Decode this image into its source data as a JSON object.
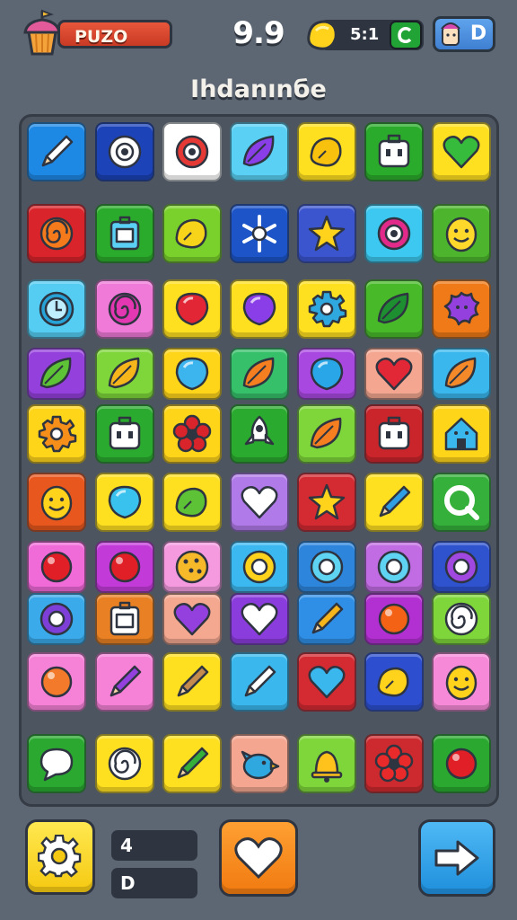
{
  "hud": {
    "player_label": "PUZO",
    "score": "9.9",
    "coins": "5:1",
    "profile_value": "D"
  },
  "title": "Ihdanınбe",
  "bottom": {
    "stat_top": "4",
    "stat_bottom": "D"
  },
  "colors": {
    "background": "#5d6774",
    "board": "#4d5560"
  },
  "board": {
    "rows": [
      [
        {
          "bg": "#1e88e5",
          "icon": "pencil-icon",
          "fg": "#ffffff"
        },
        {
          "bg": "#1c43b8",
          "icon": "target-icon",
          "fg": "#ffffff"
        },
        {
          "bg": "#ffffff",
          "icon": "target-icon",
          "fg": "#e53935"
        },
        {
          "bg": "#5ad0f4",
          "icon": "leaf-icon",
          "fg": "#8a3ee8"
        },
        {
          "bg": "#ffe020",
          "icon": "lemon-icon",
          "fg": "#f7c10e"
        },
        {
          "bg": "#2bab2b",
          "icon": "robot-icon",
          "fg": "#ffffff"
        },
        {
          "bg": "#ffe020",
          "icon": "heart-icon",
          "fg": "#36bb3c"
        }
      ],
      [
        {
          "bg": "#d8242a",
          "icon": "swirl-icon",
          "fg": "#f47a1c"
        },
        {
          "bg": "#2bab2b",
          "icon": "box-icon",
          "fg": "#5ad0f4"
        },
        {
          "bg": "#7bd12c",
          "icon": "lemon-icon",
          "fg": "#f7d31a"
        },
        {
          "bg": "#1d55c8",
          "icon": "snowflake-icon",
          "fg": "#ffffff"
        },
        {
          "bg": "#3b55cf",
          "icon": "star-icon",
          "fg": "#ffd21c"
        },
        {
          "bg": "#3cc8f0",
          "icon": "target-icon",
          "fg": "#e22a8a"
        },
        {
          "bg": "#4cb52d",
          "icon": "smiley-icon",
          "fg": "#ffd82c"
        }
      ],
      [
        {
          "bg": "#55cdf2",
          "icon": "clock-icon",
          "fg": "#28a3d8"
        },
        {
          "bg": "#ef7ad8",
          "icon": "swirl-icon",
          "fg": "#e338b1"
        },
        {
          "bg": "#ffe020",
          "icon": "balloon-icon",
          "fg": "#e32636"
        },
        {
          "bg": "#ffe020",
          "icon": "balloon-icon",
          "fg": "#8a3ee8"
        },
        {
          "bg": "#ffe020",
          "icon": "gear-icon",
          "fg": "#2fa8e0"
        },
        {
          "bg": "#48ba2a",
          "icon": "leaf-icon",
          "fg": "#1e8f30"
        },
        {
          "bg": "#ef7a17",
          "icon": "splat-icon",
          "fg": "#9340df"
        }
      ],
      [
        {
          "bg": "#9440dc",
          "icon": "leaf-icon",
          "fg": "#5dc236"
        },
        {
          "bg": "#7ed63a",
          "icon": "leaf-icon",
          "fg": "#f6b51a"
        },
        {
          "bg": "#ffd51a",
          "icon": "balloon-icon",
          "fg": "#3cb4ee"
        },
        {
          "bg": "#35c069",
          "icon": "leaf-icon",
          "fg": "#f47e20"
        },
        {
          "bg": "#a948e0",
          "icon": "balloon-icon",
          "fg": "#28a6e8"
        },
        {
          "bg": "#f4a690",
          "icon": "heart-icon",
          "fg": "#e22836"
        },
        {
          "bg": "#3ab8ee",
          "icon": "leaf-icon",
          "fg": "#f4892a"
        }
      ],
      [
        {
          "bg": "#ffd51a",
          "icon": "gear-icon",
          "fg": "#f58f1a"
        },
        {
          "bg": "#2aaa2e",
          "icon": "robot-icon",
          "fg": "#ffffff"
        },
        {
          "bg": "#ffd51a",
          "icon": "flower-icon",
          "fg": "#d8242a"
        },
        {
          "bg": "#2aaa2e",
          "icon": "rocket-icon",
          "fg": "#ffffff"
        },
        {
          "bg": "#7ed63a",
          "icon": "leaf-icon",
          "fg": "#f47e20"
        },
        {
          "bg": "#c9252b",
          "icon": "robot-icon",
          "fg": "#ffffff"
        },
        {
          "bg": "#ffd51a",
          "icon": "house-icon",
          "fg": "#3ab8ee"
        }
      ],
      [
        {
          "bg": "#e8571e",
          "icon": "smiley-icon",
          "fg": "#ffd21c"
        },
        {
          "bg": "#ffe020",
          "icon": "balloon-icon",
          "fg": "#3ac2ee"
        },
        {
          "bg": "#ffe020",
          "icon": "lemon-icon",
          "fg": "#5dc236"
        },
        {
          "bg": "#b07be8",
          "icon": "heart-icon",
          "fg": "#ffffff"
        },
        {
          "bg": "#d42a32",
          "icon": "star-icon",
          "fg": "#ffd21c"
        },
        {
          "bg": "#ffe020",
          "icon": "pencil-icon",
          "fg": "#2f9ee4"
        },
        {
          "bg": "#35b03a",
          "icon": "search-icon",
          "fg": "#ffffff"
        }
      ],
      [
        {
          "bg": "#f06ad8",
          "icon": "dot-icon",
          "fg": "#e02026"
        },
        {
          "bg": "#c23bd8",
          "icon": "dot-icon",
          "fg": "#e02026"
        },
        {
          "bg": "#f59adf",
          "icon": "cookie-icon",
          "fg": "#f6b92a"
        },
        {
          "bg": "#3cb8f0",
          "icon": "ring-icon",
          "fg": "#ffd21c"
        },
        {
          "bg": "#2e86dc",
          "icon": "ring-icon",
          "fg": "#5ed3f2"
        },
        {
          "bg": "#c16ce2",
          "icon": "ring-icon",
          "fg": "#5ed3f2"
        },
        {
          "bg": "#2f52cf",
          "icon": "ring-icon",
          "fg": "#a048e0"
        }
      ],
      [
        {
          "bg": "#3aaaea",
          "icon": "ring-icon",
          "fg": "#7e3ed8"
        },
        {
          "bg": "#e98124",
          "icon": "box-icon",
          "fg": "#ffffff"
        },
        {
          "bg": "#f4a890",
          "icon": "heart-icon",
          "fg": "#9340df"
        },
        {
          "bg": "#8b3cdc",
          "icon": "heart-icon",
          "fg": "#ffffff"
        },
        {
          "bg": "#2f8fe6",
          "icon": "pencil-icon",
          "fg": "#f6b51a"
        },
        {
          "bg": "#b22fd2",
          "icon": "dot-icon",
          "fg": "#f46216"
        },
        {
          "bg": "#7ed63a",
          "icon": "swirl-icon",
          "fg": "#ffffff"
        }
      ],
      [
        {
          "bg": "#f682d8",
          "icon": "dot-icon",
          "fg": "#f27a2a"
        },
        {
          "bg": "#f682d8",
          "icon": "pencil-icon",
          "fg": "#9340df"
        },
        {
          "bg": "#ffe020",
          "icon": "pencil-icon",
          "fg": "#c48a4e"
        },
        {
          "bg": "#3ab8ee",
          "icon": "pencil-icon",
          "fg": "#ffffff"
        },
        {
          "bg": "#d42a32",
          "icon": "heart-icon",
          "fg": "#3ab8ee"
        },
        {
          "bg": "#2d4fcf",
          "icon": "lemon-icon",
          "fg": "#ffd21c"
        },
        {
          "bg": "#f68ad8",
          "icon": "smiley-icon",
          "fg": "#ffd21c"
        }
      ],
      [
        {
          "bg": "#2aa830",
          "icon": "speech-bubble-icon",
          "fg": "#ffffff"
        },
        {
          "bg": "#ffe020",
          "icon": "swirl-icon",
          "fg": "#ffffff"
        },
        {
          "bg": "#ffe020",
          "icon": "pencil-icon",
          "fg": "#36b03a"
        },
        {
          "bg": "#f4a690",
          "icon": "bird-icon",
          "fg": "#2fa8e0"
        },
        {
          "bg": "#7ed63a",
          "icon": "bell-icon",
          "fg": "#ffc21c"
        },
        {
          "bg": "#cc2a2e",
          "icon": "flower-icon",
          "fg": "#e82a2a"
        },
        {
          "bg": "#2aa830",
          "icon": "dot-icon",
          "fg": "#e02026"
        }
      ]
    ]
  }
}
